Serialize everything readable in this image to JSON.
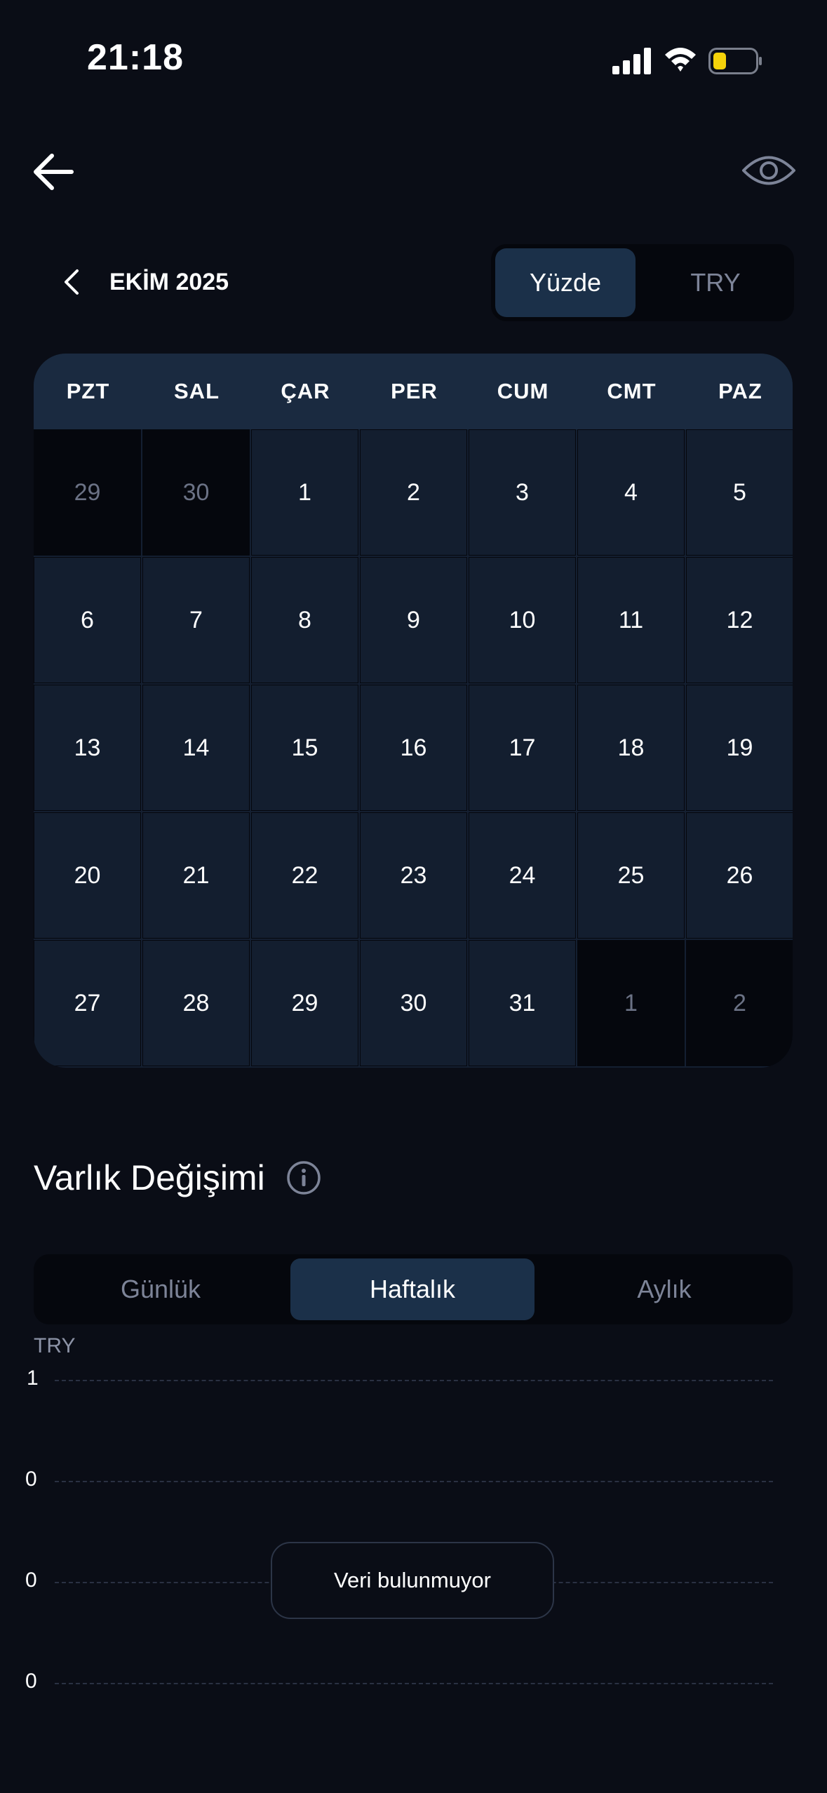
{
  "status_bar": {
    "time": "21:18"
  },
  "month": {
    "label": "EKİM 2025"
  },
  "mode_toggle": {
    "options": [
      "Yüzde",
      "TRY"
    ],
    "selected": "Yüzde"
  },
  "calendar": {
    "weekdays": [
      "PZT",
      "SAL",
      "ÇAR",
      "PER",
      "CUM",
      "CMT",
      "PAZ"
    ],
    "weeks": [
      [
        "29",
        "30",
        "1",
        "2",
        "3",
        "4",
        "5"
      ],
      [
        "6",
        "7",
        "8",
        "9",
        "10",
        "11",
        "12"
      ],
      [
        "13",
        "14",
        "15",
        "16",
        "17",
        "18",
        "19"
      ],
      [
        "20",
        "21",
        "22",
        "23",
        "24",
        "25",
        "26"
      ],
      [
        "27",
        "28",
        "29",
        "30",
        "31",
        "1",
        "2"
      ]
    ],
    "outside_month": [
      [
        0,
        0
      ],
      [
        0,
        1
      ],
      [
        4,
        5
      ],
      [
        4,
        6
      ]
    ]
  },
  "section": {
    "title": "Varlık Değişimi"
  },
  "period_toggle": {
    "options": [
      "Günlük",
      "Haftalık",
      "Aylık"
    ],
    "selected": "Haftalık"
  },
  "chart": {
    "unit": "TRY",
    "y_ticks": [
      "1",
      "0",
      "0",
      "0"
    ],
    "empty_message": "Veri bulunmuyor"
  },
  "colors": {
    "accent": "#1b3049",
    "background": "#0a0d16",
    "battery": "#f5d20a"
  },
  "icons": [
    "signal-icon",
    "wifi-icon",
    "battery-icon",
    "back-arrow-icon",
    "eye-icon",
    "chevron-left-icon",
    "info-icon"
  ]
}
